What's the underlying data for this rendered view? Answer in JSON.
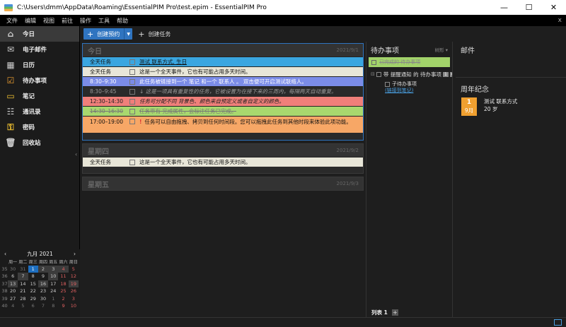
{
  "window": {
    "title": "C:\\Users\\dmm\\AppData\\Roaming\\EssentialPIM Pro\\test.epim - EssentialPIM Pro",
    "minimize": "—",
    "maximize": "☐",
    "close": "✕"
  },
  "menu": {
    "items": [
      "文件",
      "编辑",
      "视图",
      "前往",
      "操作",
      "工具",
      "帮助"
    ],
    "close_x": "x"
  },
  "sidebar": {
    "items": [
      {
        "label": "今日",
        "icon": "⌂"
      },
      {
        "label": "电子邮件",
        "icon": "✉"
      },
      {
        "label": "日历",
        "icon": "▦"
      },
      {
        "label": "待办事项",
        "icon": "☑"
      },
      {
        "label": "笔记",
        "icon": "▭"
      },
      {
        "label": "通讯录",
        "icon": "☷"
      },
      {
        "label": "密码",
        "icon": "⚿"
      },
      {
        "label": "回收站",
        "icon": "🗑"
      }
    ],
    "collapse": "‹"
  },
  "minical": {
    "prev": "‹",
    "next": "›",
    "title": "九月  2021",
    "weekdays": [
      "周一",
      "周二",
      "周三",
      "周四",
      "周五",
      "周六",
      "周日"
    ],
    "weeks": [
      {
        "wk": "35",
        "days": [
          "30",
          "31",
          "1",
          "2",
          "3",
          "4",
          "5"
        ]
      },
      {
        "wk": "36",
        "days": [
          "6",
          "7",
          "8",
          "9",
          "10",
          "11",
          "12"
        ]
      },
      {
        "wk": "37",
        "days": [
          "13",
          "14",
          "15",
          "16",
          "17",
          "18",
          "19"
        ]
      },
      {
        "wk": "38",
        "days": [
          "20",
          "21",
          "22",
          "23",
          "24",
          "25",
          "26"
        ]
      },
      {
        "wk": "39",
        "days": [
          "27",
          "28",
          "29",
          "30",
          "1",
          "2",
          "3"
        ]
      },
      {
        "wk": "40",
        "days": [
          "4",
          "5",
          "6",
          "7",
          "8",
          "9",
          "10"
        ]
      }
    ]
  },
  "toolbar": {
    "new_appointment": "创建预约",
    "new_task": "创建任务",
    "plus": "+",
    "dropdown": "▼"
  },
  "days": [
    {
      "name": "今日",
      "date": "2021/9/1",
      "events": [
        {
          "time": "全天任务",
          "text": "测试 联系方式, 生日",
          "bg": "#3aa6e0",
          "fg": "#111"
        },
        {
          "time": "全天任务",
          "text": "这是一个全天事件，它也有可能占用多天时间。",
          "bg": "#e8e6d8",
          "fg": "#111"
        },
        {
          "time": "8:30–9:30",
          "text": "此任务被链接到一个 笔记 和一个 联系人 。 双击便可开启测试联络人。",
          "bg": "#7b8ce8",
          "fg": "#fff"
        },
        {
          "time": "8:30–9:45",
          "text": "↓ 这是一项具有重复性的任务，它被设置为在接下来的三周内，每隔两天自动重复。",
          "bg": "#2a2a2a",
          "fg": "#999"
        },
        {
          "time": "12:30–14:30",
          "text": "任务可分配不同 背景色、颜色来自预定义或者自定义的颜色。",
          "bg": "#f07f7a",
          "fg": "#222"
        },
        {
          "time": "14:30–16:30",
          "text": "任务带有 完成属性，会标注任务已完成。",
          "bg": "#a8d86e",
          "fg": "#777"
        },
        {
          "time": "17:00–19:00",
          "text": "任务可以自由拖拽、拷贝到任何时间段。您可以拖拽此任务到其他时段来体验此项功能。",
          "bg": "#f7a766",
          "fg": "#111",
          "flag": "!"
        }
      ]
    },
    {
      "name": "星期四",
      "date": "2021/9/2",
      "events": [
        {
          "time": "全天任务",
          "text": "这是一个全天事件，它也有可能占用多天时间。",
          "bg": "#e8e6d8",
          "fg": "#111"
        }
      ]
    },
    {
      "name": "星期五",
      "date": "2021/9/3",
      "events": []
    }
  ],
  "tasks": {
    "title": "待办事项",
    "mode": "树形 ▾",
    "done_task": "已完成的 待办事项",
    "main_task": "带 提醒通知 的 待办事项",
    "main_badge_a": "1",
    "main_badge_b": "0",
    "expand": "⊟",
    "subtask": "子待办事项",
    "subtask_link": "(链接到笔记)",
    "footer": "列表 1",
    "add": "+"
  },
  "mail": {
    "title": "邮件"
  },
  "anniversary": {
    "title": "周年纪念",
    "day": "1",
    "month": "9月",
    "name": "测试 联系方式",
    "age": "20 岁",
    "color": "#f0a030"
  }
}
